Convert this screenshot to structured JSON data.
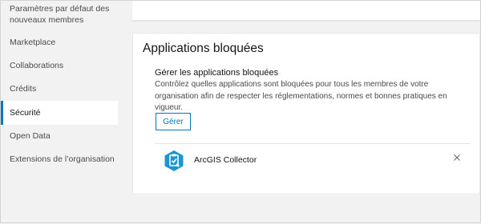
{
  "sidebar": {
    "items": [
      {
        "label": "Paramètres par défaut des nouveaux membres"
      },
      {
        "label": "Marketplace"
      },
      {
        "label": "Collaborations"
      },
      {
        "label": "Crédits"
      },
      {
        "label": "Sécurité",
        "active": true
      },
      {
        "label": "Open Data"
      },
      {
        "label": "Extensions de l’organisation"
      }
    ]
  },
  "section": {
    "title": "Applications bloquées",
    "subtitle": "Gérer les applications bloquées",
    "description": "Contrôlez quelles applications sont bloquées pour tous les membres de votre organisation afin de respecter les réglementations, normes et bonnes pratiques en vigueur.",
    "manage_label": "Gérer",
    "apps": [
      {
        "name": "ArcGIS Collector",
        "icon": "collector-app-icon",
        "icon_color": "#1d94d4"
      }
    ],
    "remove_icon": "close-icon"
  },
  "colors": {
    "accent": "#0079c1",
    "background": "#f2f2f2"
  }
}
